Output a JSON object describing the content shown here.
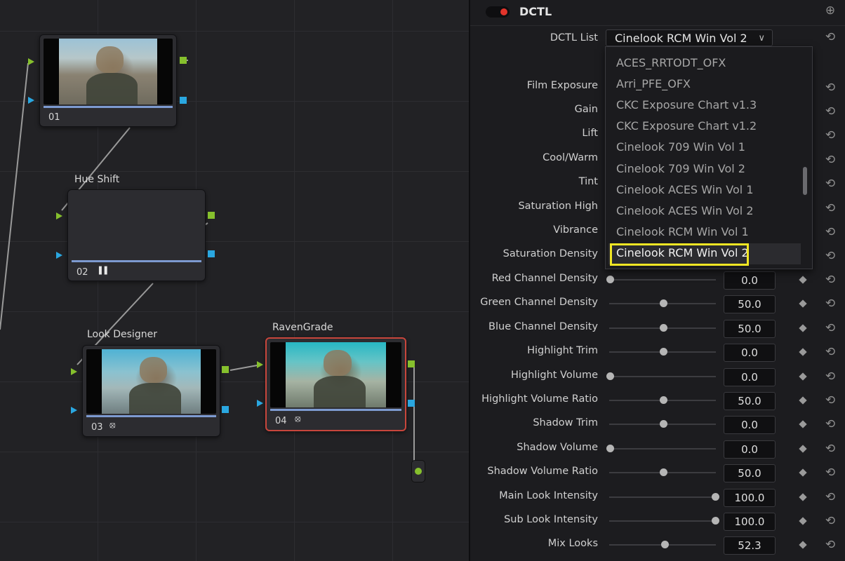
{
  "node_editor": {
    "nodes": [
      {
        "id": "01",
        "title": "",
        "number": "01",
        "icon": ""
      },
      {
        "id": "02",
        "title": "Hue Shift",
        "number": "02",
        "icon": "bars-icon"
      },
      {
        "id": "03",
        "title": "Look Designer",
        "number": "03",
        "icon": "ofx-icon"
      },
      {
        "id": "04",
        "title": "RavenGrade",
        "number": "04",
        "icon": "ofx-icon"
      }
    ],
    "icons": {
      "bars": "▐▐",
      "ofx": "⦻"
    }
  },
  "panel": {
    "title": "DCTL",
    "dctl_list_label": "DCTL List",
    "dctl_selected": "Cinelook RCM Win Vol 2",
    "reset_glyph": "⟲",
    "add_glyph": "⊕",
    "chevron": "∨",
    "dropdown_options": [
      "ACES_RRTODT_OFX",
      "Arri_PFE_OFX",
      "CKC Exposure Chart v1.3",
      "CKC Exposure Chart v1.2",
      "Cinelook 709 Win Vol 1",
      "Cinelook 709 Win Vol 2",
      "Cinelook ACES Win Vol 1",
      "Cinelook ACES Win Vol 2",
      "Cinelook RCM Win Vol 1",
      "Cinelook RCM Win Vol 2"
    ],
    "hidden_labels": [
      "Film Exposure",
      "Gain",
      "Lift",
      "Cool/Warm",
      "Tint",
      "Saturation High",
      "Vibrance",
      "Saturation Density"
    ],
    "params": [
      {
        "label": "Red Channel Density",
        "value": "0.0"
      },
      {
        "label": "Green Channel Density",
        "value": "50.0"
      },
      {
        "label": "Blue Channel Density",
        "value": "50.0"
      },
      {
        "label": "Highlight Trim",
        "value": "0.0"
      },
      {
        "label": "Highlight Volume",
        "value": "0.0"
      },
      {
        "label": "Highlight Volume Ratio",
        "value": "50.0"
      },
      {
        "label": "Shadow Trim",
        "value": "0.0"
      },
      {
        "label": "Shadow Volume",
        "value": "0.0"
      },
      {
        "label": "Shadow Volume Ratio",
        "value": "50.0"
      },
      {
        "label": "Main Look Intensity",
        "value": "100.0"
      },
      {
        "label": "Sub Look Intensity",
        "value": "100.0"
      },
      {
        "label": "Mix Looks",
        "value": "52.3"
      }
    ]
  },
  "colors": {
    "green_port": "#86c02d",
    "blue_port": "#2aa7e0",
    "selected_node_border": "#c8463c",
    "highlight_box": "#f1e624",
    "toggle_on": "#e2342b"
  }
}
